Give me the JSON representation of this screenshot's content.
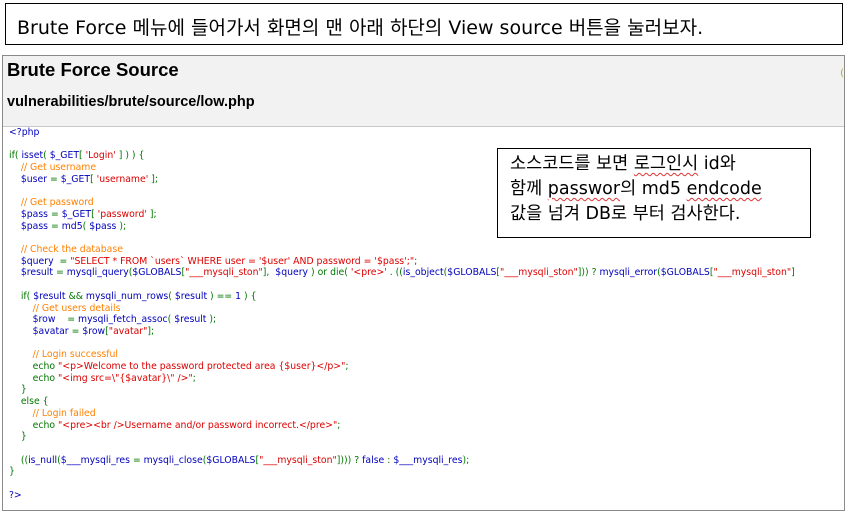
{
  "caption": "Brute Force 메뉴에 들어가서 화면의 맨 아래 하단의 View source 버튼을 눌러보자.",
  "page": {
    "title": "Brute Force Source",
    "path": "vulnerabilities/brute/source/low.php"
  },
  "code_lines": [
    [
      [
        "def",
        "<?php"
      ]
    ],
    [],
    [
      [
        "kw",
        "if( "
      ],
      [
        "def",
        "isset"
      ],
      [
        "kw",
        "( "
      ],
      [
        "def",
        "$_GET"
      ],
      [
        "kw",
        "[ "
      ],
      [
        "str",
        "'Login'"
      ],
      [
        "kw",
        " ] ) ) {"
      ]
    ],
    [
      [
        "cmt",
        "    // Get username"
      ]
    ],
    [
      [
        "def",
        "    $user "
      ],
      [
        "kw",
        "= "
      ],
      [
        "def",
        "$_GET"
      ],
      [
        "kw",
        "[ "
      ],
      [
        "str",
        "'username'"
      ],
      [
        "kw",
        " ];"
      ]
    ],
    [],
    [
      [
        "cmt",
        "    // Get password"
      ]
    ],
    [
      [
        "def",
        "    $pass "
      ],
      [
        "kw",
        "= "
      ],
      [
        "def",
        "$_GET"
      ],
      [
        "kw",
        "[ "
      ],
      [
        "str",
        "'password'"
      ],
      [
        "kw",
        " ];"
      ]
    ],
    [
      [
        "def",
        "    $pass "
      ],
      [
        "kw",
        "= "
      ],
      [
        "def",
        "md5"
      ],
      [
        "kw",
        "( "
      ],
      [
        "def",
        "$pass"
      ],
      [
        "kw",
        " );"
      ]
    ],
    [],
    [
      [
        "cmt",
        "    // Check the database"
      ]
    ],
    [
      [
        "def",
        "    $query  "
      ],
      [
        "kw",
        "= "
      ],
      [
        "str",
        "\"SELECT * FROM `users` WHERE user = '$user' AND password = '$pass';\""
      ],
      [
        "kw",
        ";"
      ]
    ],
    [
      [
        "def",
        "    $result "
      ],
      [
        "kw",
        "= "
      ],
      [
        "def",
        "mysqli_query"
      ],
      [
        "kw",
        "("
      ],
      [
        "def",
        "$GLOBALS"
      ],
      [
        "kw",
        "["
      ],
      [
        "str",
        "\"___mysqli_ston\""
      ],
      [
        "kw",
        "],  "
      ],
      [
        "def",
        "$query"
      ],
      [
        "kw",
        " ) or die( "
      ],
      [
        "str",
        "'<pre>'"
      ],
      [
        "kw",
        " . (("
      ],
      [
        "def",
        "is_object"
      ],
      [
        "kw",
        "("
      ],
      [
        "def",
        "$GLOBALS"
      ],
      [
        "kw",
        "["
      ],
      [
        "str",
        "\"___mysqli_ston\""
      ],
      [
        "kw",
        "])) ? "
      ],
      [
        "def",
        "mysqli_error"
      ],
      [
        "kw",
        "("
      ],
      [
        "def",
        "$GLOBALS"
      ],
      [
        "kw",
        "["
      ],
      [
        "str",
        "\"___mysqli_ston\""
      ],
      [
        "kw",
        "]"
      ]
    ],
    [],
    [
      [
        "kw",
        "    if( "
      ],
      [
        "def",
        "$result"
      ],
      [
        "kw",
        " && "
      ],
      [
        "def",
        "mysqli_num_rows"
      ],
      [
        "kw",
        "( "
      ],
      [
        "def",
        "$result"
      ],
      [
        "kw",
        " ) == "
      ],
      [
        "def",
        "1"
      ],
      [
        "kw",
        " ) {"
      ]
    ],
    [
      [
        "cmt",
        "        // Get users details"
      ]
    ],
    [
      [
        "def",
        "        $row    "
      ],
      [
        "kw",
        "= "
      ],
      [
        "def",
        "mysqli_fetch_assoc"
      ],
      [
        "kw",
        "( "
      ],
      [
        "def",
        "$result"
      ],
      [
        "kw",
        " );"
      ]
    ],
    [
      [
        "def",
        "        $avatar "
      ],
      [
        "kw",
        "= "
      ],
      [
        "def",
        "$row"
      ],
      [
        "kw",
        "["
      ],
      [
        "str",
        "\"avatar\""
      ],
      [
        "kw",
        "];"
      ]
    ],
    [],
    [
      [
        "cmt",
        "        // Login successful"
      ]
    ],
    [
      [
        "kw",
        "        echo "
      ],
      [
        "str",
        "\"<p>Welcome to the password protected area {$user}</p>\""
      ],
      [
        "kw",
        ";"
      ]
    ],
    [
      [
        "kw",
        "        echo "
      ],
      [
        "str",
        "\"<img src=\\\"{$avatar}\\\" />\""
      ],
      [
        "kw",
        ";"
      ]
    ],
    [
      [
        "kw",
        "    }"
      ]
    ],
    [
      [
        "kw",
        "    else {"
      ]
    ],
    [
      [
        "cmt",
        "        // Login failed"
      ]
    ],
    [
      [
        "kw",
        "        echo "
      ],
      [
        "str",
        "\"<pre><br />Username and/or password incorrect.</pre>\""
      ],
      [
        "kw",
        ";"
      ]
    ],
    [
      [
        "kw",
        "    }"
      ]
    ],
    [],
    [
      [
        "kw",
        "    (("
      ],
      [
        "def",
        "is_null"
      ],
      [
        "kw",
        "("
      ],
      [
        "def",
        "$___mysqli_res"
      ],
      [
        "kw",
        " = "
      ],
      [
        "def",
        "mysqli_close"
      ],
      [
        "kw",
        "("
      ],
      [
        "def",
        "$GLOBALS"
      ],
      [
        "kw",
        "["
      ],
      [
        "str",
        "\"___mysqli_ston\""
      ],
      [
        "kw",
        "]))) ? "
      ],
      [
        "def",
        "false"
      ],
      [
        "kw",
        " : "
      ],
      [
        "def",
        "$___mysqli_res"
      ],
      [
        "kw",
        ");"
      ]
    ],
    [
      [
        "kw",
        "}"
      ]
    ],
    [],
    [
      [
        "def",
        "?>"
      ]
    ]
  ],
  "annotation": {
    "line1_a": "소스코드를 보면 ",
    "line1_sq": "로그인시",
    "line1_b": " id와",
    "line2_a": "함께 ",
    "line2_sq": "passwor",
    "line2_b": "의 md5 ",
    "line2_sq2": "endcode",
    "line3": "값을 넘겨 DB로 부터 검사한다."
  },
  "colors": {
    "keyword": "#007700",
    "string": "#dd0000",
    "comment": "#ff8000",
    "identifier": "#0000bb"
  }
}
